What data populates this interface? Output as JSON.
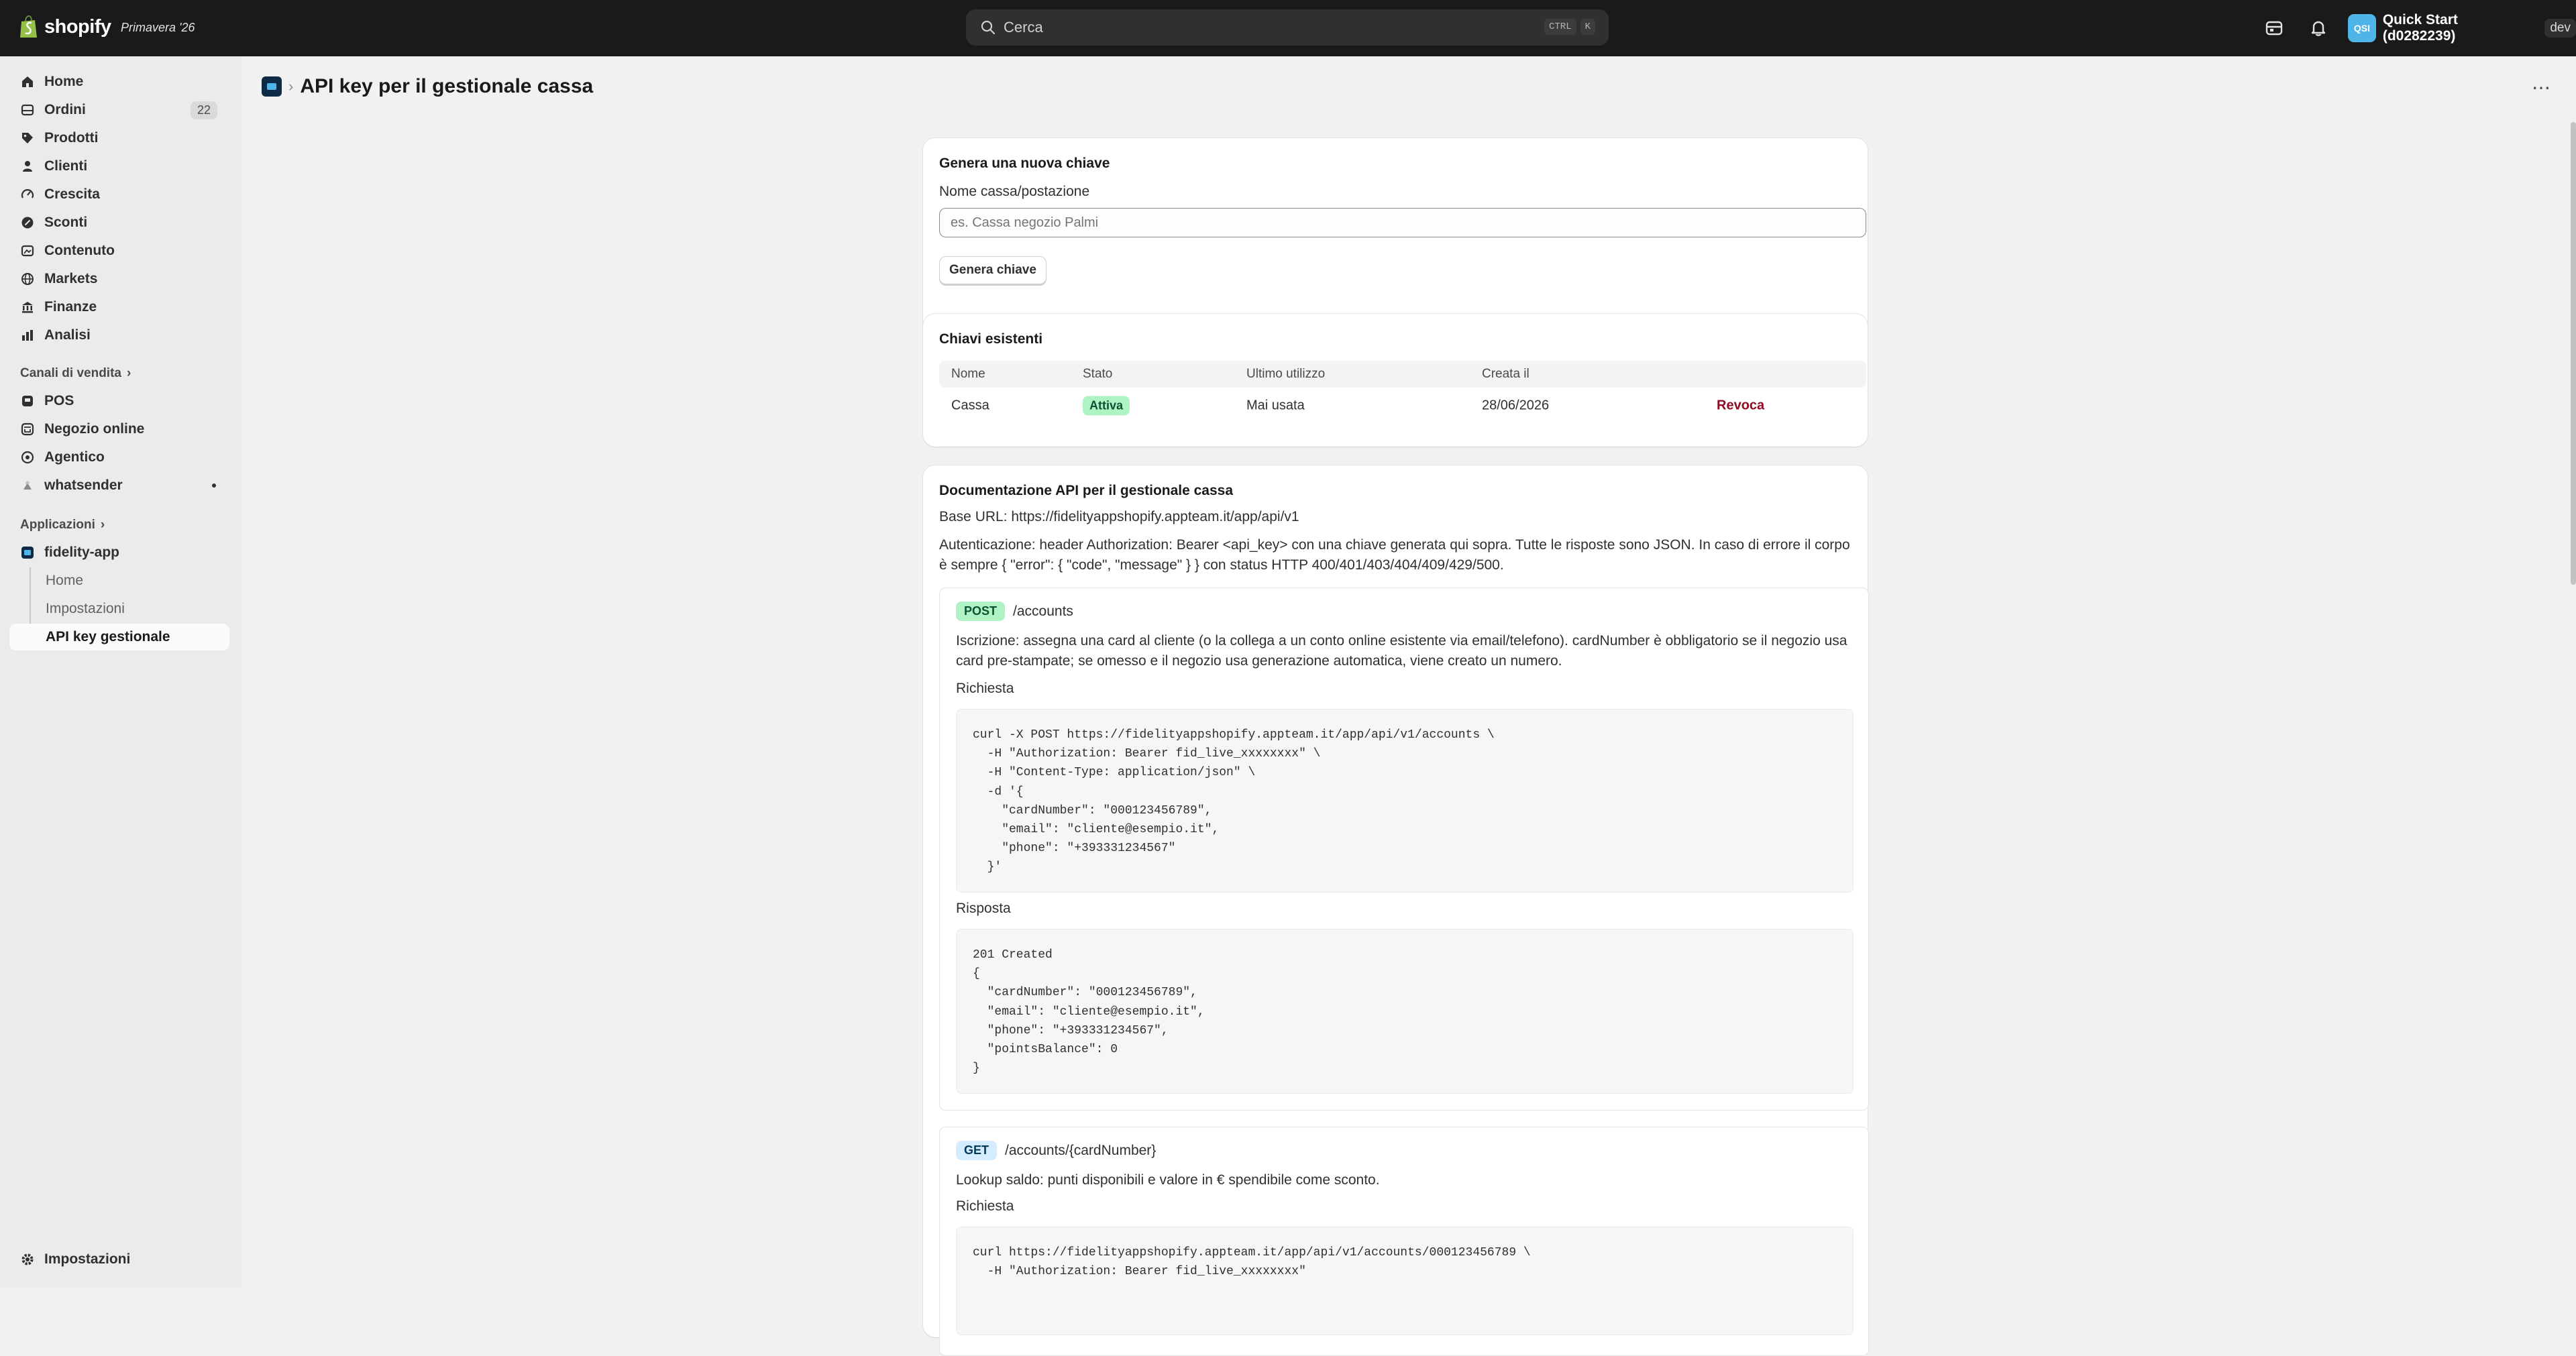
{
  "topbar": {
    "logo_text": "shopify",
    "edition": "Primavera '26",
    "search_placeholder": "Cerca",
    "shortcut_key1": "CTRL",
    "shortcut_key2": "K",
    "store_initials": "QSI",
    "store_name": "Quick Start (d0282239)",
    "env_badge": "dev",
    "icons": [
      "pos-icon",
      "bell-icon"
    ]
  },
  "sidebar": {
    "items": [
      {
        "label": "Home",
        "icon": "home-icon"
      },
      {
        "label": "Ordini",
        "icon": "orders-icon",
        "badge": "22"
      },
      {
        "label": "Prodotti",
        "icon": "tag-icon"
      },
      {
        "label": "Clienti",
        "icon": "person-icon"
      },
      {
        "label": "Crescita",
        "icon": "growth-icon"
      },
      {
        "label": "Sconti",
        "icon": "discount-icon"
      },
      {
        "label": "Contenuto",
        "icon": "content-icon"
      },
      {
        "label": "Markets",
        "icon": "globe-icon"
      },
      {
        "label": "Finanze",
        "icon": "bank-icon"
      },
      {
        "label": "Analisi",
        "icon": "chart-icon"
      }
    ],
    "sales_channels_heading": "Canali di vendita",
    "channels": [
      {
        "label": "POS",
        "icon": "pos-icon"
      },
      {
        "label": "Negozio online",
        "icon": "store-icon"
      },
      {
        "label": "Agentico",
        "icon": "agent-icon"
      },
      {
        "label": "whatsender",
        "icon": "app-icon"
      }
    ],
    "apps_heading": "Applicazioni",
    "app_name": "fidelity-app",
    "app_subitems": [
      "Home",
      "Impostazioni",
      "API key gestionale"
    ],
    "settings_label": "Impostazioni"
  },
  "page": {
    "title": "API key per il gestionale cassa",
    "more_label": "⋯"
  },
  "generate": {
    "heading": "Genera una nuova chiave",
    "field_label": "Nome cassa/postazione",
    "placeholder": "es. Cassa negozio Palmi",
    "button": "Genera chiave"
  },
  "keys": {
    "heading": "Chiavi esistenti",
    "columns": [
      "Nome",
      "Stato",
      "Ultimo utilizzo",
      "Creata il"
    ],
    "rows": [
      {
        "name": "Cassa",
        "status": "Attiva",
        "last_used": "Mai usata",
        "created": "28/06/2026",
        "action": "Revoca"
      }
    ]
  },
  "docs": {
    "heading": "Documentazione API per il gestionale cassa",
    "base_url": "Base URL: https://fidelityappshopify.appteam.it/app/api/v1",
    "auth": "Autenticazione: header Authorization: Bearer <api_key> con una chiave generata qui sopra. Tutte le risposte sono JSON. In caso di errore il corpo è sempre { \"error\": { \"code\", \"message\" } } con status HTTP 400/401/403/404/409/429/500.",
    "endpoints": [
      {
        "method": "POST",
        "path": "/accounts",
        "description": "Iscrizione: assegna una card al cliente (o la collega a un conto online esistente via email/telefono). cardNumber è obbligatorio se il negozio usa card pre-stampate; se omesso e il negozio usa generazione automatica, viene creato un numero.",
        "request_label": "Richiesta",
        "request": "curl -X POST https://fidelityappshopify.appteam.it/app/api/v1/accounts \\\n  -H \"Authorization: Bearer fid_live_xxxxxxxx\" \\\n  -H \"Content-Type: application/json\" \\\n  -d '{\n    \"cardNumber\": \"000123456789\",\n    \"email\": \"cliente@esempio.it\",\n    \"phone\": \"+393331234567\"\n  }'",
        "response_label": "Risposta",
        "response": "201 Created\n{\n  \"cardNumber\": \"000123456789\",\n  \"email\": \"cliente@esempio.it\",\n  \"phone\": \"+393331234567\",\n  \"pointsBalance\": 0\n}"
      },
      {
        "method": "GET",
        "path": "/accounts/{cardNumber}",
        "description": "Lookup saldo: punti disponibili e valore in € spendibile come sconto.",
        "request_label": "Richiesta",
        "request": "curl https://fidelityappshopify.appteam.it/app/api/v1/accounts/000123456789 \\\n  -H \"Authorization: Bearer fid_live_xxxxxxxx\""
      }
    ]
  }
}
